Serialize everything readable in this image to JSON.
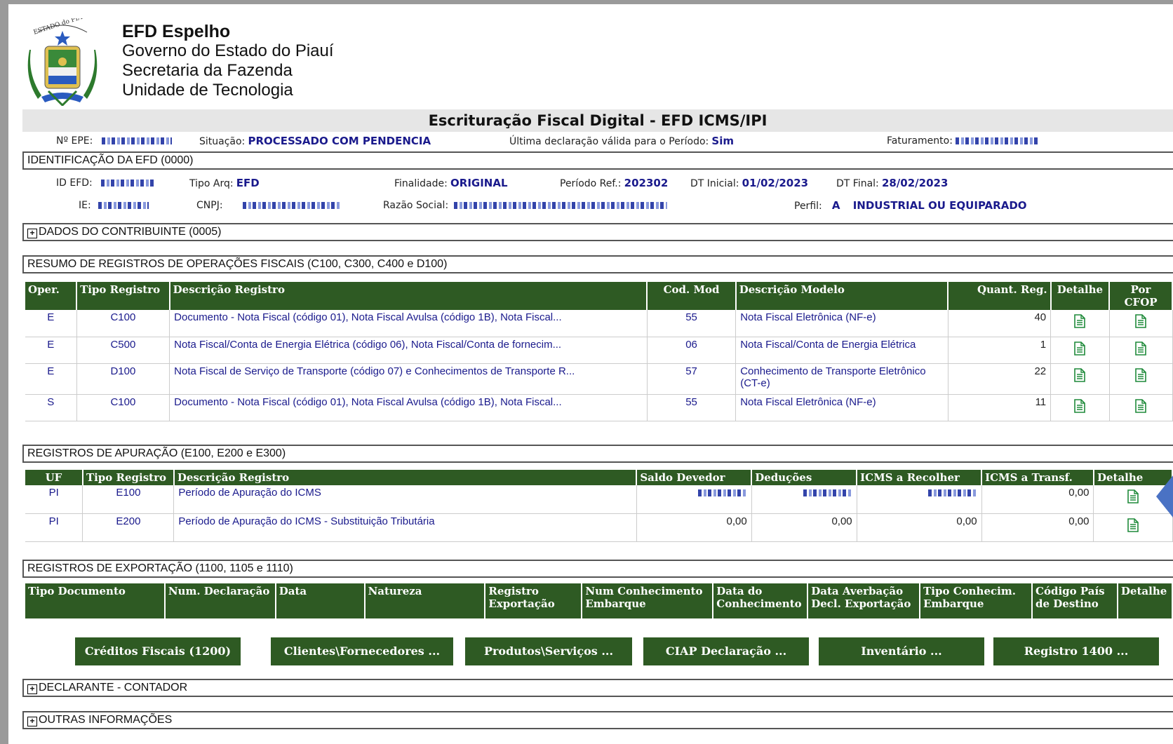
{
  "header": {
    "app_title": "EFD Espelho",
    "line2": "Governo do Estado do Piauí",
    "line3": "Secretaria da Fazenda",
    "line4": "Unidade de Tecnologia"
  },
  "title": "Escrituração Fiscal Digital - EFD ICMS/IPI",
  "info": {
    "epe_label": "Nº EPE:",
    "situacao_label": "Situação:",
    "situacao_value": "PROCESSADO COM PENDENCIA",
    "ultima_label": "Última declaração válida para o Período:",
    "ultima_value": "Sim",
    "faturamento_label": "Faturamento:"
  },
  "ident": {
    "section_title": "IDENTIFICAÇÃO DA EFD (0000)",
    "id_label": "ID EFD:",
    "tipo_label": "Tipo Arq:",
    "tipo_value": "EFD",
    "finalidade_label": "Finalidade:",
    "finalidade_value": "ORIGINAL",
    "periodo_label": "Período Ref.:",
    "periodo_value": "202302",
    "dtini_label": "DT Inicial:",
    "dtini_value": "01/02/2023",
    "dtfim_label": "DT Final:",
    "dtfim_value": "28/02/2023",
    "ie_label": "IE:",
    "cnpj_label": "CNPJ:",
    "razao_label": "Razão Social:",
    "perfil_label": "Perfil:",
    "perfil_code": "A",
    "perfil_value": "INDUSTRIAL OU EQUIPARADO"
  },
  "sections": {
    "contribuinte": "DADOS DO CONTRIBUINTE (0005)",
    "resumo": "RESUMO DE REGISTROS DE OPERAÇÕES FISCAIS (C100, C300, C400 e D100)",
    "apuracao": "REGISTROS DE APURAÇÃO (E100, E200 e E300)",
    "exportacao": "REGISTROS DE EXPORTAÇÃO (1100, 1105 e 1110)",
    "declarante": "DECLARANTE - CONTADOR",
    "outras": "OUTRAS INFORMAÇÕES"
  },
  "resumo_table": {
    "headers": [
      "Oper.",
      "Tipo Registro",
      "Descrição Registro",
      "Cod. Mod",
      "Descrição Modelo",
      "Quant. Reg.",
      "Detalhe",
      "Por CFOP"
    ],
    "rows": [
      {
        "oper": "E",
        "tipo": "C100",
        "desc": "Documento - Nota Fiscal (código 01), Nota Fiscal Avulsa (código 1B), Nota Fiscal...",
        "cod": "55",
        "modelo": "Nota Fiscal Eletrônica (NF-e)",
        "quant": "40"
      },
      {
        "oper": "E",
        "tipo": "C500",
        "desc": "Nota Fiscal/Conta de Energia Elétrica (código 06), Nota Fiscal/Conta de fornecim...",
        "cod": "06",
        "modelo": "Nota Fiscal/Conta de Energia Elétrica",
        "quant": "1"
      },
      {
        "oper": "E",
        "tipo": "D100",
        "desc": "Nota Fiscal de Serviço de Transporte (código 07) e Conhecimentos de Transporte R...",
        "cod": "57",
        "modelo": "Conhecimento de Transporte Eletrônico (CT-e)",
        "quant": "22"
      },
      {
        "oper": "S",
        "tipo": "C100",
        "desc": "Documento - Nota Fiscal (código 01), Nota Fiscal Avulsa (código 1B), Nota Fiscal...",
        "cod": "55",
        "modelo": "Nota Fiscal Eletrônica (NF-e)",
        "quant": "11"
      }
    ]
  },
  "apuracao_table": {
    "headers": [
      "UF",
      "Tipo Registro",
      "Descrição Registro",
      "Saldo Devedor",
      "Deduções",
      "ICMS a Recolher",
      "ICMS a Transf.",
      "Detalhe"
    ],
    "rows": [
      {
        "uf": "PI",
        "tipo": "E100",
        "desc": "Período de Apuração do ICMS",
        "transf": "0,00"
      },
      {
        "uf": "PI",
        "tipo": "E200",
        "desc": "Período de Apuração do ICMS - Substituição Tributária",
        "saldo": "0,00",
        "deducoes": "0,00",
        "recolher": "0,00",
        "transf": "0,00"
      }
    ]
  },
  "exportacao_table": {
    "headers": [
      "Tipo Documento",
      "Num. Declaração",
      "Data",
      "Natureza",
      "Registro Exportação",
      "Num Conhecimento Embarque",
      "Data do Conhecimento",
      "Data Averbação Decl. Exportação",
      "Tipo Conhecim. Embarque",
      "Código País de Destino",
      "Detalhe"
    ]
  },
  "buttons": {
    "creditos": "Créditos Fiscais (1200)",
    "clientes": "Clientes\\Fornecedores ...",
    "produtos": "Produtos\\Serviços ...",
    "ciap": "CIAP Declaração ...",
    "inventario": "Inventário ...",
    "registro1400": "Registro 1400 ..."
  },
  "colors": {
    "green": "#2e5a23",
    "link": "#1a1a8c",
    "icon_green": "#1f8a3a"
  }
}
